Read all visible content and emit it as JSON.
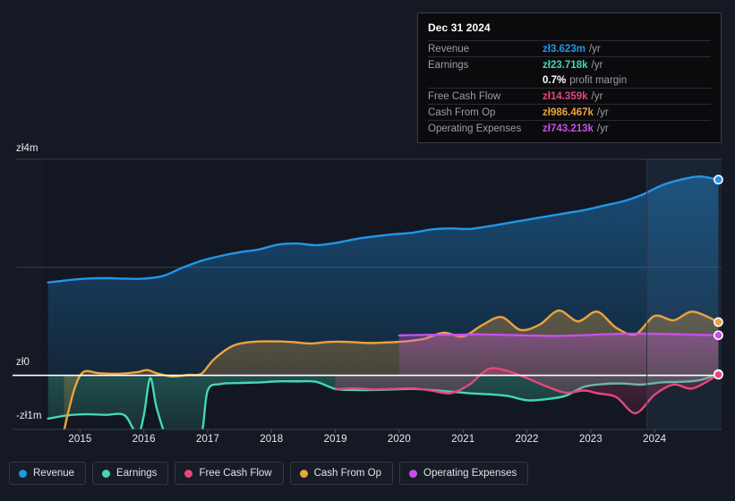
{
  "tooltip": {
    "date": "Dec 31 2024",
    "rows": [
      {
        "label": "Revenue",
        "value": "zł3.623m",
        "unit": "/yr"
      },
      {
        "label": "Earnings",
        "value": "zł23.718k",
        "unit": "/yr"
      },
      {
        "label": "",
        "value": "0.7%",
        "unit": "profit margin"
      },
      {
        "label": "Free Cash Flow",
        "value": "zł14.359k",
        "unit": "/yr"
      },
      {
        "label": "Cash From Op",
        "value": "zł986.467k",
        "unit": "/yr"
      },
      {
        "label": "Operating Expenses",
        "value": "zł743.213k",
        "unit": "/yr"
      }
    ]
  },
  "legend": {
    "items": [
      {
        "label": "Revenue",
        "color": "#2196e8"
      },
      {
        "label": "Earnings",
        "color": "#44d7b6"
      },
      {
        "label": "Free Cash Flow",
        "color": "#e8467c"
      },
      {
        "label": "Cash From Op",
        "color": "#eba33f"
      },
      {
        "label": "Operating Expenses",
        "color": "#c84fe8"
      }
    ]
  },
  "chart_data": {
    "type": "area",
    "title": "",
    "xlabel": "",
    "ylabel": "",
    "currency": "zł",
    "ylim": [
      -1.0,
      4.0
    ],
    "y_unit": "millions",
    "grid": true,
    "legend_position": "bottom",
    "zero_line": 0,
    "y_ticks": [
      {
        "value": 4,
        "label": "zł4m"
      },
      {
        "value": 0,
        "label": "zł0"
      },
      {
        "value": -1,
        "label": "-zł1m"
      }
    ],
    "y_gridlines": [
      4,
      2,
      0,
      -1
    ],
    "x_ticks": [
      "2015",
      "2016",
      "2017",
      "2018",
      "2019",
      "2020",
      "2021",
      "2022",
      "2023",
      "2024"
    ],
    "x_range": [
      "2014-06",
      "2025-03"
    ],
    "forecast_boundary": "2023-12",
    "series": [
      {
        "name": "Revenue",
        "color": "#2196e8",
        "x": [
          2014.5,
          2014.8,
          2015.1,
          2015.4,
          2015.7,
          2016.0,
          2016.3,
          2016.6,
          2016.9,
          2017.2,
          2017.5,
          2017.8,
          2018.1,
          2018.4,
          2018.7,
          2019.0,
          2019.3,
          2019.6,
          2019.9,
          2020.2,
          2020.5,
          2020.8,
          2021.1,
          2021.4,
          2021.7,
          2022.0,
          2022.3,
          2022.6,
          2022.9,
          2023.2,
          2023.5,
          2023.8,
          2024.1,
          2024.4,
          2024.7,
          2025.0
        ],
        "values": [
          1.72,
          1.76,
          1.79,
          1.8,
          1.79,
          1.79,
          1.84,
          1.99,
          2.12,
          2.21,
          2.28,
          2.33,
          2.42,
          2.44,
          2.41,
          2.45,
          2.52,
          2.57,
          2.61,
          2.64,
          2.7,
          2.72,
          2.71,
          2.76,
          2.82,
          2.88,
          2.94,
          3.0,
          3.06,
          3.14,
          3.22,
          3.34,
          3.51,
          3.62,
          3.68,
          3.623
        ]
      },
      {
        "name": "Earnings",
        "color": "#44d7b6",
        "x": [
          2014.5,
          2014.8,
          2015.1,
          2015.4,
          2015.7,
          2015.9,
          2016.0,
          2016.1,
          2016.2,
          2016.35,
          2016.5,
          2016.7,
          2016.9,
          2017.0,
          2017.2,
          2017.5,
          2017.8,
          2018.1,
          2018.4,
          2018.7,
          2019.0,
          2019.3,
          2019.6,
          2019.9,
          2020.2,
          2020.5,
          2020.8,
          2021.1,
          2021.4,
          2021.7,
          2022.0,
          2022.3,
          2022.6,
          2022.9,
          2023.2,
          2023.5,
          2023.8,
          2024.1,
          2024.4,
          2024.7,
          2025.0
        ],
        "values": [
          -0.8,
          -0.74,
          -0.72,
          -0.73,
          -0.74,
          -1.1,
          -0.74,
          -0.05,
          -0.6,
          -1.12,
          -1.12,
          -1.12,
          -1.1,
          -0.28,
          -0.16,
          -0.14,
          -0.13,
          -0.11,
          -0.11,
          -0.12,
          -0.25,
          -0.27,
          -0.27,
          -0.26,
          -0.25,
          -0.27,
          -0.3,
          -0.33,
          -0.35,
          -0.38,
          -0.46,
          -0.44,
          -0.38,
          -0.21,
          -0.16,
          -0.15,
          -0.17,
          -0.13,
          -0.12,
          -0.09,
          0.024
        ]
      },
      {
        "name": "Free Cash Flow",
        "color": "#e8467c",
        "x": [
          2019.0,
          2019.3,
          2019.6,
          2019.9,
          2020.2,
          2020.5,
          2020.8,
          2021.1,
          2021.4,
          2021.7,
          2022.0,
          2022.3,
          2022.6,
          2022.9,
          2023.1,
          2023.4,
          2023.7,
          2024.0,
          2024.3,
          2024.6,
          2025.0
        ],
        "values": [
          -0.26,
          -0.24,
          -0.26,
          -0.25,
          -0.24,
          -0.28,
          -0.33,
          -0.17,
          0.12,
          0.08,
          -0.05,
          -0.2,
          -0.32,
          -0.28,
          -0.33,
          -0.4,
          -0.7,
          -0.36,
          -0.17,
          -0.24,
          0.014
        ]
      },
      {
        "name": "Cash From Op",
        "color": "#eba33f",
        "x": [
          2014.75,
          2014.9,
          2015.05,
          2015.3,
          2015.6,
          2015.9,
          2016.05,
          2016.2,
          2016.45,
          2016.7,
          2016.9,
          2017.1,
          2017.4,
          2017.7,
          2018.0,
          2018.3,
          2018.6,
          2018.9,
          2019.2,
          2019.5,
          2019.8,
          2020.1,
          2020.4,
          2020.7,
          2021.0,
          2021.3,
          2021.6,
          2021.9,
          2022.2,
          2022.5,
          2022.8,
          2023.1,
          2023.4,
          2023.7,
          2024.0,
          2024.3,
          2024.6,
          2025.0
        ],
        "values": [
          -1.02,
          -0.3,
          0.06,
          0.04,
          0.03,
          0.06,
          0.1,
          0.04,
          -0.02,
          0.01,
          0.03,
          0.3,
          0.55,
          0.62,
          0.63,
          0.62,
          0.59,
          0.62,
          0.62,
          0.6,
          0.61,
          0.63,
          0.68,
          0.79,
          0.72,
          0.93,
          1.08,
          0.84,
          0.94,
          1.2,
          1.0,
          1.18,
          0.88,
          0.76,
          1.1,
          1.02,
          1.18,
          0.986
        ]
      },
      {
        "name": "Operating Expenses",
        "color": "#c84fe8",
        "x": [
          2020.0,
          2020.4,
          2020.8,
          2021.2,
          2021.6,
          2022.0,
          2022.4,
          2022.8,
          2023.2,
          2023.6,
          2024.0,
          2024.4,
          2024.7,
          2025.0
        ],
        "values": [
          0.74,
          0.75,
          0.75,
          0.76,
          0.75,
          0.74,
          0.73,
          0.74,
          0.76,
          0.77,
          0.77,
          0.76,
          0.75,
          0.743
        ]
      }
    ]
  }
}
